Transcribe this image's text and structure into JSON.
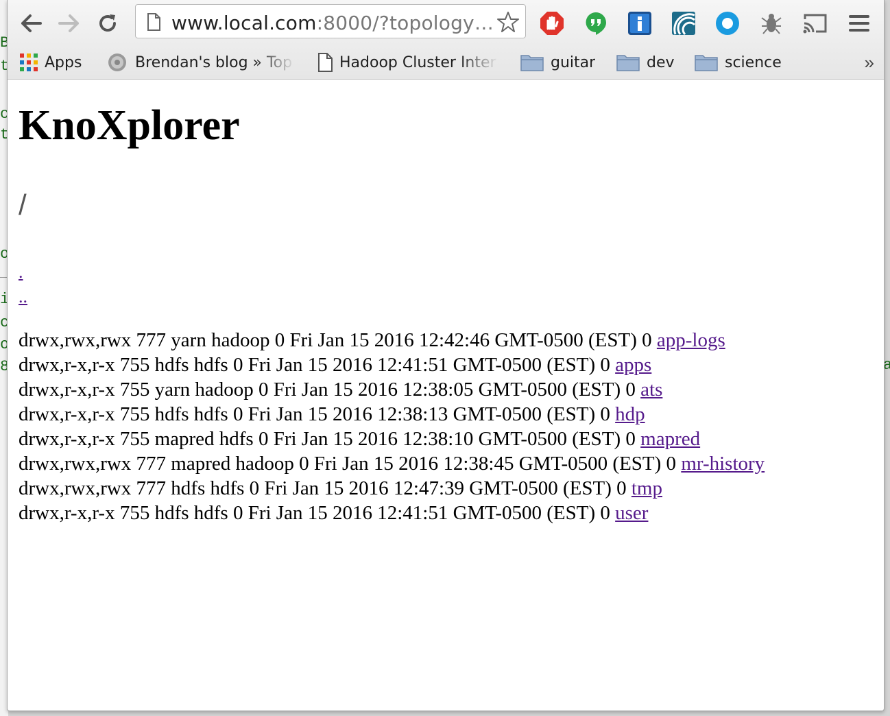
{
  "browser": {
    "url_main": "www.local.com",
    "url_rest": ":8000/?topology…",
    "bookmarks": [
      {
        "label": "Apps",
        "icon": "apps-grid-icon"
      },
      {
        "label": "Brendan's blog » Top",
        "icon": "gear-favicon-icon"
      },
      {
        "label": "Hadoop Cluster Inter",
        "icon": "page-icon"
      },
      {
        "label": "guitar",
        "icon": "folder-icon"
      },
      {
        "label": "dev",
        "icon": "folder-icon"
      },
      {
        "label": "science",
        "icon": "folder-icon"
      }
    ],
    "overflow": "»"
  },
  "page": {
    "title": "KnoXplorer",
    "path": "/",
    "dot": ".",
    "dotdot": "..",
    "entries": [
      {
        "info": "drwx,rwx,rwx 777 yarn hadoop 0 Fri Jan 15 2016 12:42:46 GMT-0500 (EST) 0 ",
        "name": "app-logs"
      },
      {
        "info": "drwx,r-x,r-x 755 hdfs hdfs 0 Fri Jan 15 2016 12:41:51 GMT-0500 (EST) 0 ",
        "name": "apps"
      },
      {
        "info": "drwx,r-x,r-x 755 yarn hadoop 0 Fri Jan 15 2016 12:38:05 GMT-0500 (EST) 0 ",
        "name": "ats"
      },
      {
        "info": "drwx,r-x,r-x 755 hdfs hdfs 0 Fri Jan 15 2016 12:38:13 GMT-0500 (EST) 0 ",
        "name": "hdp"
      },
      {
        "info": "drwx,r-x,r-x 755 mapred hdfs 0 Fri Jan 15 2016 12:38:10 GMT-0500 (EST) 0 ",
        "name": "mapred"
      },
      {
        "info": "drwx,rwx,rwx 777 mapred hadoop 0 Fri Jan 15 2016 12:38:45 GMT-0500 (EST) 0 ",
        "name": "mr-history"
      },
      {
        "info": "drwx,rwx,rwx 777 hdfs hdfs 0 Fri Jan 15 2016 12:47:39 GMT-0500 (EST) 0 ",
        "name": "tmp"
      },
      {
        "info": "drwx,r-x,r-x 755 hdfs hdfs 0 Fri Jan 15 2016 12:41:51 GMT-0500 (EST) 0 ",
        "name": "user"
      }
    ]
  },
  "colors": {
    "link_visited": "#551a8b",
    "ext_red": "#e0342b",
    "ext_green": "#2ea84a",
    "ext_blue": "#1a78c2"
  }
}
